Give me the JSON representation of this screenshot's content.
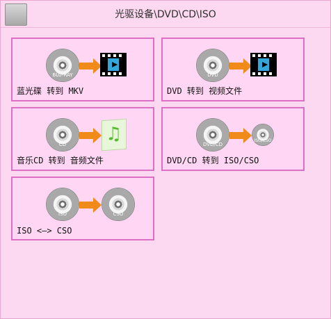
{
  "window": {
    "title": "光驱设备\\DVD\\CD\\ISO"
  },
  "tiles": [
    {
      "label": "蓝光碟 转到 MKV",
      "disc_label": "BLU-RAY"
    },
    {
      "label": "DVD 转到 视频文件",
      "disc_label": "DVD"
    },
    {
      "label": "音乐CD 转到 音频文件",
      "disc_label": "CD"
    },
    {
      "label": "DVD/CD 转到 ISO/CSO",
      "disc_label": "DVD/CD",
      "target_label": "ISO/CSO"
    },
    {
      "label": "ISO <—> CSO",
      "disc_label": "ISO",
      "target_label": "CSO"
    }
  ],
  "colors": {
    "background": "#fdd9f1",
    "tile_border": "#dc6ec6",
    "arrow": "#f08a19",
    "music": "#57bb2e",
    "play": "#34a6d9"
  }
}
